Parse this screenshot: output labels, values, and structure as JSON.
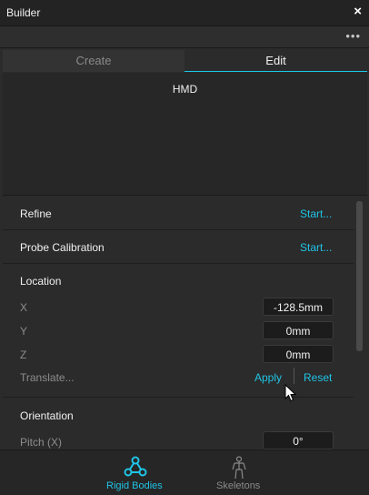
{
  "window": {
    "title": "Builder",
    "close_icon": "×",
    "more_icon": "•••"
  },
  "tabs": [
    {
      "label": "Create"
    },
    {
      "label": "Edit"
    }
  ],
  "viewport": {
    "asset_name": "HMD"
  },
  "refine": {
    "label": "Refine",
    "action": "Start..."
  },
  "probe": {
    "label": "Probe Calibration",
    "action": "Start..."
  },
  "location": {
    "heading": "Location",
    "x": {
      "label": "X",
      "value": "-128.5mm"
    },
    "y": {
      "label": "Y",
      "value": "0mm"
    },
    "z": {
      "label": "Z",
      "value": "0mm"
    },
    "translate": {
      "label": "Translate...",
      "apply": "Apply",
      "reset": "Reset"
    }
  },
  "orientation": {
    "heading": "Orientation",
    "pitch": {
      "label": "Pitch (X)",
      "value": "0°"
    }
  },
  "bottom_nav": [
    {
      "label": "Rigid Bodies",
      "icon": "rigid-bodies-icon"
    },
    {
      "label": "Skeletons",
      "icon": "skeleton-icon"
    }
  ],
  "colors": {
    "accent": "#1fc4e6",
    "background": "#2b2b2b"
  }
}
